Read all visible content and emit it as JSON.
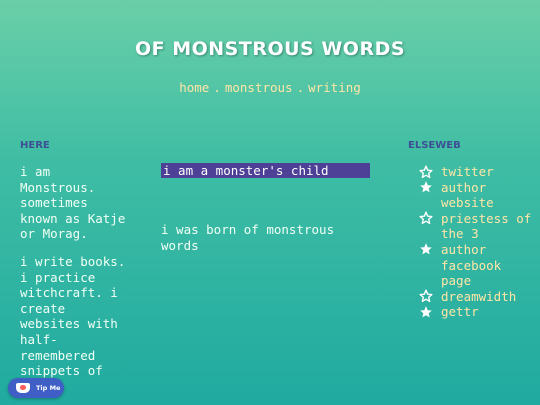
{
  "site": {
    "title": "OF MONSTROUS WORDS"
  },
  "nav": {
    "items": [
      "home",
      "monstrous",
      "writing"
    ],
    "separator": "."
  },
  "here": {
    "heading": "HERE",
    "paragraphs": [
      "i am Monstrous. sometimes known as Katje or Morag.",
      "i write books. i practice witchcraft. i create websites with half-remembered snippets of"
    ]
  },
  "main": {
    "highlight": "i am a monster's child",
    "subtext": "i was born of monstrous words"
  },
  "elseweb": {
    "heading": "ELSEWEB",
    "links": [
      {
        "label": "twitter",
        "icon": "star-outline-icon"
      },
      {
        "label": "author website",
        "icon": "star-filled-icon"
      },
      {
        "label": "priestess of the 3",
        "icon": "star-outline-icon"
      },
      {
        "label": "author facebook page",
        "icon": "star-filled-icon"
      },
      {
        "label": "dreamwidth",
        "icon": "star-outline-icon"
      },
      {
        "label": "gettr",
        "icon": "star-filled-icon"
      }
    ]
  },
  "tip_button": {
    "label": "Tip Me"
  },
  "colors": {
    "heading": "#3d4f95",
    "link": "#ffe6a6",
    "highlight_bg": "#4e3f97",
    "tip_bg": "#3f5ec6"
  }
}
